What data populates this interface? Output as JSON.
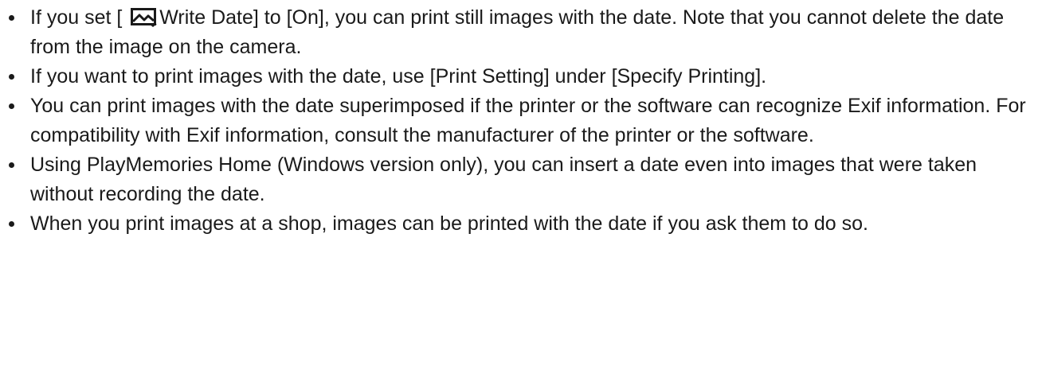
{
  "notes": [
    {
      "before_icon": "If you set [ ",
      "icon": "still-image-icon",
      "after_icon": "Write Date] to [On], you can print still images with the date. Note that you cannot delete the date from the image on the camera."
    },
    {
      "text": "If you want to print images with the date, use [Print Setting] under [Specify Printing]."
    },
    {
      "text": "You can print images with the date superimposed if the printer or the software can recognize Exif information. For compatibility with Exif information, consult the manufacturer of the printer or the software."
    },
    {
      "text": "Using PlayMemories Home (Windows version only), you can insert a date even into images that were taken without recording the date."
    },
    {
      "text": "When you print images at a shop, images can be printed with the date if you ask them to do so."
    }
  ]
}
